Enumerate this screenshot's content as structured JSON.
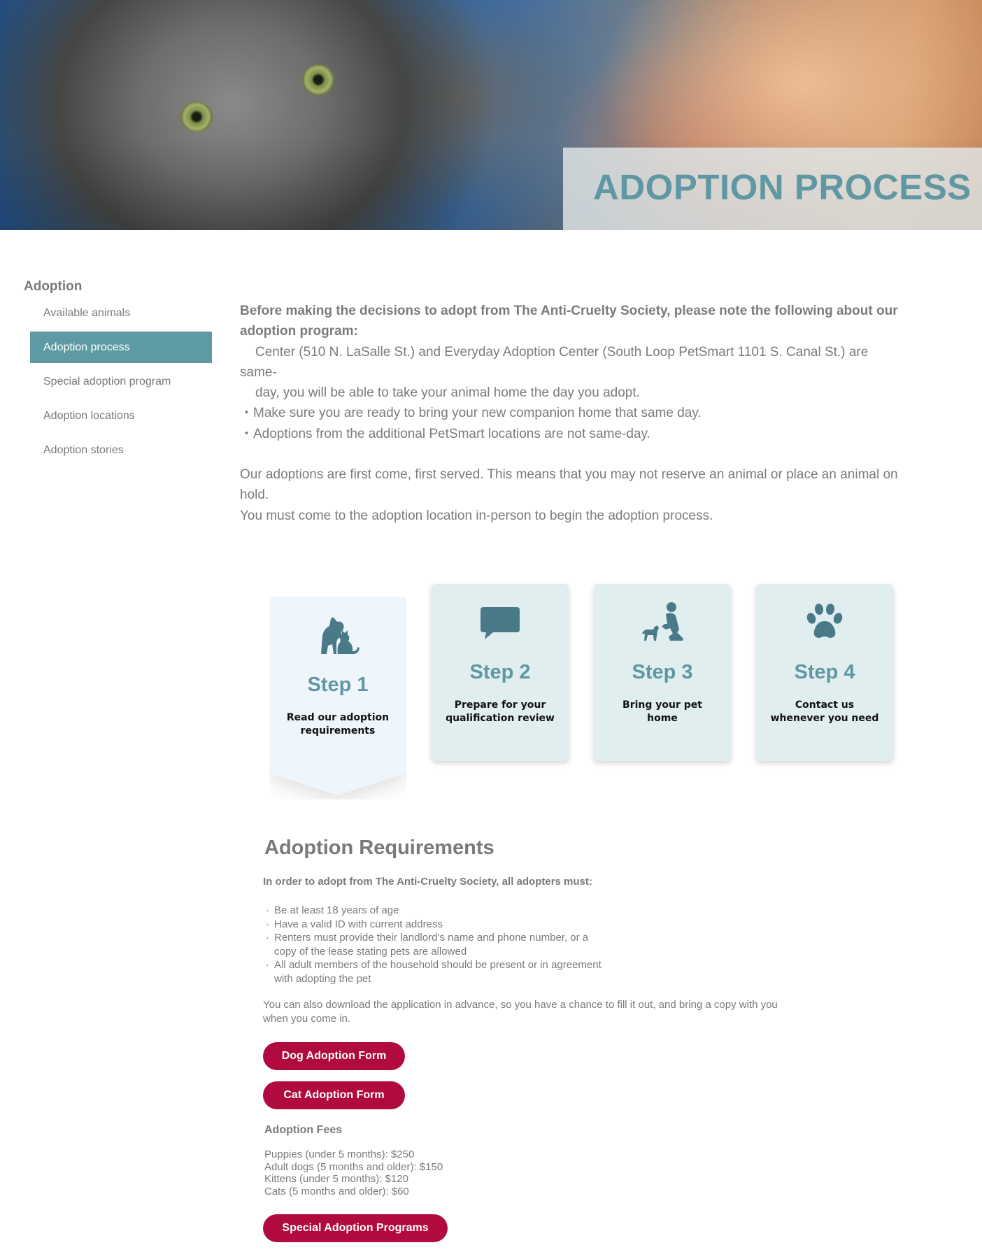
{
  "hero": {
    "title": "ADOPTION PROCESS",
    "image_alt": "gray tabby cat held in a person's arms"
  },
  "sidebar": {
    "heading": "Adoption",
    "items": [
      {
        "label": "Available animals",
        "active": false
      },
      {
        "label": "Adoption process",
        "active": true
      },
      {
        "label": "Special adoption program",
        "active": false
      },
      {
        "label": "Adoption locations",
        "active": false
      },
      {
        "label": "Adoption stories",
        "active": false
      }
    ]
  },
  "intro": {
    "lead_line1": "Before making the decisions to adopt from The Anti-Cruelty Society, please note the following about our",
    "lead_line2": "adoption program:",
    "line1": "Center (510 N. LaSalle St.) and Everyday Adoption Center (South Loop PetSmart 1101 S. Canal St.) are",
    "line2": "same-",
    "line3": "day, you will be able to take your animal home the day you adopt.",
    "bullet1": "・Make sure you are ready to bring your new companion home that same day.",
    "bullet2": "・Adoptions from the additional PetSmart locations are not same-day.",
    "para1_line1": "Our adoptions are first come, first served. This means that you may not reserve an animal or place an animal on",
    "para1_line2": "hold.",
    "para2": "You must come to the adoption location in-person to begin the adoption process."
  },
  "steps": [
    {
      "title": "Step 1",
      "desc_line1": "Read our adoption",
      "desc_line2": "requirements",
      "icon": "dog-and-cat-icon",
      "active": true
    },
    {
      "title": "Step 2",
      "desc_line1": "Prepare for your",
      "desc_line2": "qualification review",
      "icon": "speech-bubble-icon",
      "active": false
    },
    {
      "title": "Step 3",
      "desc_line1": "Bring your pet",
      "desc_line2": "home",
      "icon": "person-with-dog-icon",
      "active": false
    },
    {
      "title": "Step 4",
      "desc_line1": "Contact us",
      "desc_line2": "whenever you need",
      "icon": "paw-print-icon",
      "active": false
    }
  ],
  "requirements": {
    "title": "Adoption Requirements",
    "intro": "In order to adopt from The Anti-Cruelty Society, all adopters must:",
    "items": [
      {
        "line1": "Be at least 18 years of age",
        "line2": ""
      },
      {
        "line1": "Have a valid ID with current address",
        "line2": ""
      },
      {
        "line1": "Renters must provide their landlord’s name and phone number, or a",
        "line2": "copy of the lease stating pets are allowed"
      },
      {
        "line1": "All adult members of the household should be present or in agreement",
        "line2": "with adopting the pet"
      }
    ],
    "download_line1": "You can also download the application in advance, so you have a chance to fill it out, and bring a copy with you",
    "download_line2": "when you come in.",
    "dog_form": "Dog Adoption Form",
    "cat_form": "Cat Adoption Form"
  },
  "fees": {
    "title": "Adoption Fees",
    "items": [
      "Puppies (under 5 months): $250",
      "Adult dogs (5 months and older): $150",
      "Kittens (under 5 months): $120",
      "Cats (5 months and older): $60"
    ],
    "special_button": "Special Adoption Programs"
  },
  "colors": {
    "accent": "#5e9aa3",
    "cta": "#b00a3e",
    "step_card": "#e0eeef",
    "step_active": "#eef5fb",
    "icon": "#4a7a88"
  }
}
